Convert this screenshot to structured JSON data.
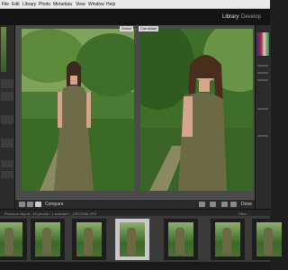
{
  "menubar": {
    "items": [
      "File",
      "Edit",
      "Library",
      "Photo",
      "Metadata",
      "View",
      "Window",
      "Help"
    ]
  },
  "modules": {
    "library": "Library",
    "develop": "Develop"
  },
  "compare": {
    "left_label": "Select",
    "right_label": "Candidate"
  },
  "toolbar": {
    "mode_label": "Compare",
    "done_label": "Done"
  },
  "filmstrip": {
    "path": "Previous Import : 45 photos / 1 selected / _DSC5436.JPG",
    "filter_label": "Filter :"
  },
  "colors": {
    "menubar": "#e9e9e9",
    "panel": "#2b2b2b",
    "center_bg": "#4a4a4a",
    "foliage": "#3d6b2b",
    "dress": "#6b6a45"
  }
}
